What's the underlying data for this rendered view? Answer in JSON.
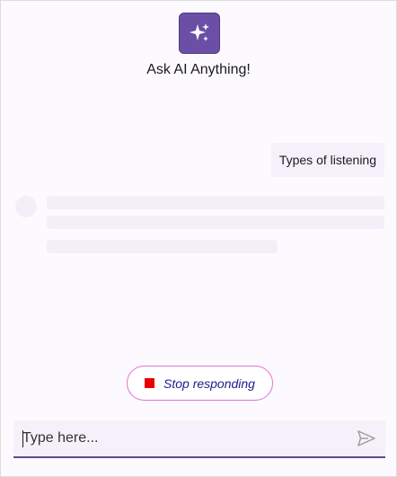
{
  "header": {
    "app_icon": "sparkles-icon",
    "title": "Ask AI Anything!"
  },
  "conversation": {
    "user_message": "Types of listening",
    "assistant_state": "loading"
  },
  "stop_button": {
    "icon": "stop-square-icon",
    "label": "Stop responding"
  },
  "composer": {
    "placeholder": "Type here...",
    "value": "",
    "send_icon": "send-icon"
  },
  "colors": {
    "accent": "#6b4fa6",
    "stop_red": "#e80000",
    "stop_border": "#e070d4",
    "input_underline": "#5d4b8a"
  }
}
